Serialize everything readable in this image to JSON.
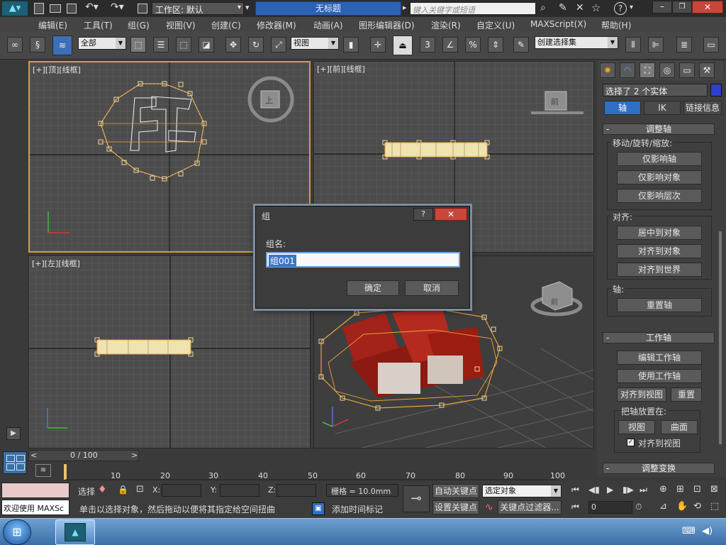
{
  "titlebar": {
    "workspace_label": "工作区: 默认",
    "doc_title": "无标题",
    "search_placeholder": "键入关键字或短语"
  },
  "menu": [
    "编辑(E)",
    "工具(T)",
    "组(G)",
    "视图(V)",
    "创建(C)",
    "修改器(M)",
    "动画(A)",
    "图形编辑器(D)",
    "渲染(R)",
    "自定义(U)",
    "MAXScript(X)",
    "帮助(H)"
  ],
  "toolbar": {
    "filter_value": "全部",
    "view_value": "视图",
    "selection_set_value": "创建选择集"
  },
  "viewports": {
    "top": "[+][顶][线框]",
    "front": "[+][前][线框]",
    "left": "[+][左][线框]",
    "viewcube_top": "上",
    "viewcube_front": "前",
    "viewcube_persp": "前"
  },
  "command_panel": {
    "selection_info": "选择了 2 个实体",
    "tabs": [
      "轴",
      "IK",
      "链接信息"
    ],
    "rollouts": {
      "adjust_pivot": {
        "title": "调整轴",
        "move_group": "移动/旋转/缩放:",
        "buttons": [
          "仅影响轴",
          "仅影响对象",
          "仅影响层次"
        ],
        "align_group": "对齐:",
        "align_buttons": [
          "居中到对象",
          "对齐到对象",
          "对齐到世界"
        ],
        "pivot_group": "轴:",
        "reset_pivot": "重置轴"
      },
      "working_pivot": {
        "title": "工作轴",
        "buttons": [
          "编辑工作轴",
          "使用工作轴"
        ],
        "align_to_view": "对齐到视图",
        "reset": "重置",
        "place_group": "把轴放置在:",
        "place_view": "视图",
        "place_surface": "曲面",
        "align_checkbox": "对齐到视图"
      },
      "adjust_transform": {
        "title": "调整变换"
      }
    }
  },
  "timeline": {
    "frame_counter": "0 / 100",
    "ticks": [
      "10",
      "20",
      "30",
      "40",
      "50",
      "60",
      "70",
      "80",
      "90",
      "100"
    ]
  },
  "status": {
    "welcome_text": "欢迎使用 MAXSc",
    "selection_label": "选择",
    "x_label": "X:",
    "y_label": "Y:",
    "z_label": "Z:",
    "grid_text": "栅格 = 10.0mm",
    "prompt": "单击以选择对象，然后拖动以便将其指定给空间扭曲",
    "add_time_tag": "添加时间标记",
    "auto_key": "自动关键点",
    "set_key": "设置关键点",
    "key_mode_value": "选定对象",
    "key_filters": "关键点过滤器...",
    "frame_value": "0"
  },
  "dialog": {
    "title": "组",
    "name_label": "组名:",
    "name_value": "组001",
    "ok": "确定",
    "cancel": "取消"
  },
  "colors": {
    "accent_blue": "#2f6fc4",
    "selection_orange": "#e9a23b",
    "object_red": "#9b1d12"
  }
}
